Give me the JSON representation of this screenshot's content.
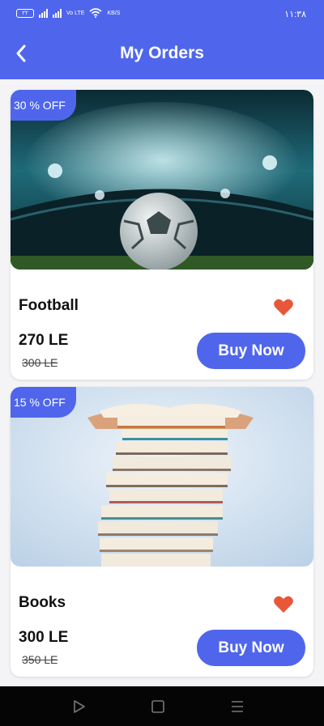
{
  "status_bar": {
    "battery": "٢٢",
    "network_label": "Vo LTE",
    "speed": "KB/S",
    "time": "١١:٣٨"
  },
  "header": {
    "title": "My Orders",
    "back_icon": "chevron-left-icon"
  },
  "orders": [
    {
      "discount": "30 % OFF",
      "name": "Football",
      "price": "270 LE",
      "old_price": "300  LE",
      "button_label": "Buy Now",
      "image": "football-stadium",
      "favorite": true
    },
    {
      "discount": "15 % OFF",
      "name": "Books",
      "price": "300 LE",
      "old_price": "350  LE",
      "button_label": "Buy Now",
      "image": "stack-of-books",
      "favorite": true
    }
  ],
  "nav_bar": {
    "back": "triangle-back-icon",
    "home": "square-home-icon",
    "menu": "menu-lines-icon"
  },
  "colors": {
    "primary": "#4f66ec",
    "heart": "#e8573a",
    "nav_background": "#050505"
  }
}
